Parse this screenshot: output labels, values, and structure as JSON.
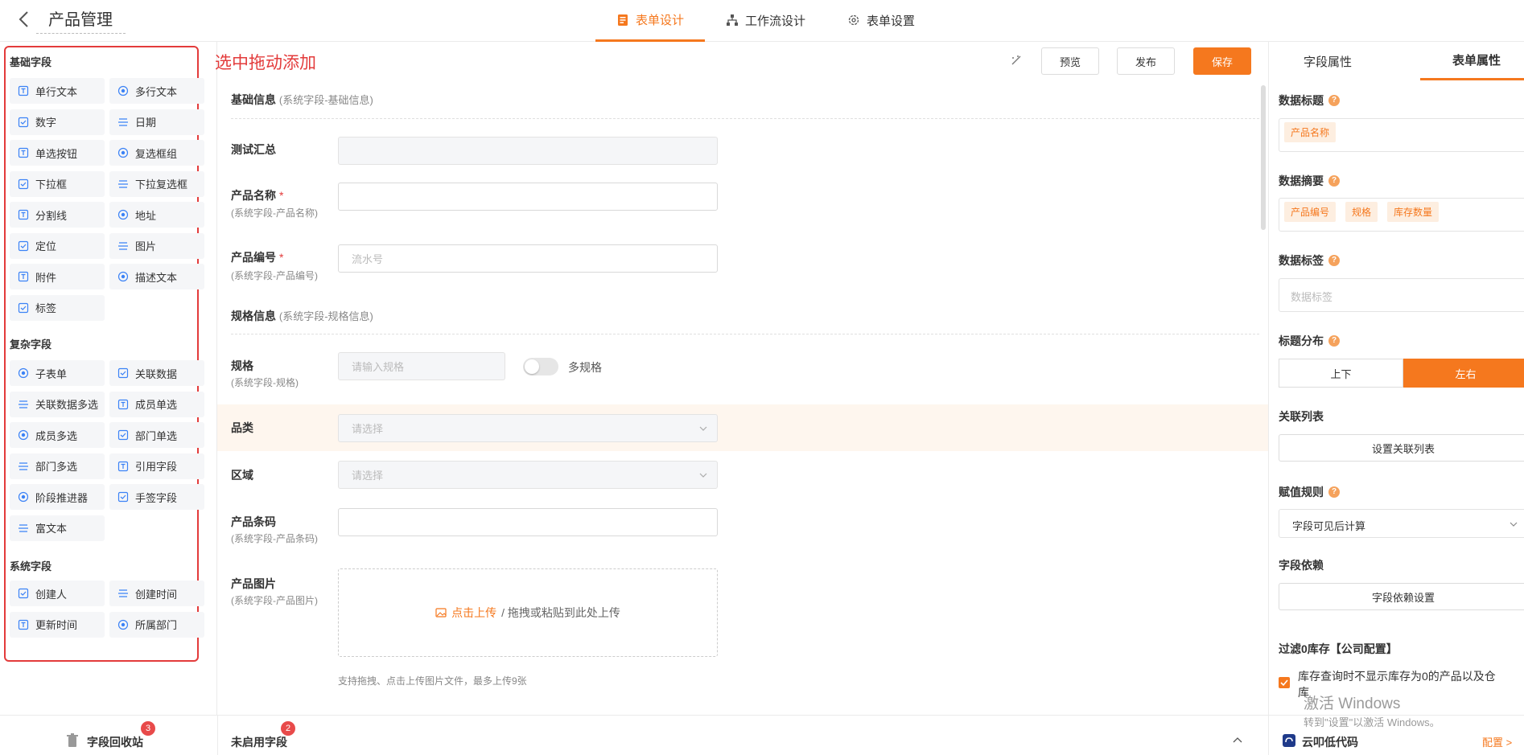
{
  "header": {
    "title": "产品管理",
    "tabs": [
      {
        "label": "表单设计",
        "active": true
      },
      {
        "label": "工作流设计"
      },
      {
        "label": "表单设置"
      }
    ]
  },
  "left": {
    "sections": [
      {
        "title": "基础字段",
        "items": [
          "单行文本",
          "多行文本",
          "数字",
          "日期",
          "单选按钮",
          "复选框组",
          "下拉框",
          "下拉复选框",
          "分割线",
          "地址",
          "定位",
          "图片",
          "附件",
          "描述文本",
          "标签"
        ]
      },
      {
        "title": "复杂字段",
        "items": [
          "子表单",
          "关联数据",
          "关联数据多选",
          "成员单选",
          "成员多选",
          "部门单选",
          "部门多选",
          "引用字段",
          "阶段推进器",
          "手签字段",
          "富文本"
        ]
      },
      {
        "title": "系统字段",
        "items": [
          "创建人",
          "创建时间",
          "更新时间",
          "所属部门"
        ]
      }
    ],
    "recycle": {
      "label": "字段回收站",
      "count": "3"
    }
  },
  "center": {
    "hint": "选中拖动添加",
    "toolbar": {
      "preview": "预览",
      "publish": "发布",
      "save": "保存"
    },
    "group1": {
      "title": "基础信息",
      "note": "(系统字段-基础信息)"
    },
    "f_total": {
      "label": "测试汇总"
    },
    "f_name": {
      "label": "产品名称",
      "sub": "(系统字段-产品名称)"
    },
    "f_code": {
      "label": "产品编号",
      "sub": "(系统字段-产品编号)",
      "placeholder": "流水号"
    },
    "group2": {
      "title": "规格信息",
      "note": "(系统字段-规格信息)"
    },
    "f_spec": {
      "label": "规格",
      "sub": "(系统字段-规格)",
      "placeholder": "请输入规格",
      "toggle": "多规格"
    },
    "f_cat": {
      "label": "品类",
      "placeholder": "请选择"
    },
    "f_area": {
      "label": "区域",
      "placeholder": "请选择"
    },
    "f_barcode": {
      "label": "产品条码",
      "sub": "(系统字段-产品条码)"
    },
    "f_img": {
      "label": "产品图片",
      "sub": "(系统字段-产品图片)",
      "upload": "点击上传",
      "upload_rest": "/ 拖拽或粘贴到此处上传",
      "help": "支持拖拽、点击上传图片文件，最多上传9张"
    },
    "unused": {
      "label": "未启用字段",
      "count": "2"
    }
  },
  "right": {
    "tabs": [
      "字段属性",
      "表单属性"
    ],
    "data_title": {
      "label": "数据标题",
      "tags": [
        "产品名称"
      ]
    },
    "data_summary": {
      "label": "数据摘要",
      "tags": [
        "产品编号",
        "规格",
        "库存数量"
      ]
    },
    "data_tag": {
      "label": "数据标签",
      "placeholder": "数据标签"
    },
    "title_layout": {
      "label": "标题分布",
      "options": [
        "上下",
        "左右"
      ],
      "selected": "左右"
    },
    "rel_list": {
      "label": "关联列表",
      "button": "设置关联列表"
    },
    "assign": {
      "label": "赋值规则",
      "value": "字段可见后计算"
    },
    "depend": {
      "label": "字段依赖",
      "button": "字段依赖设置"
    },
    "filter": {
      "label": "过滤0库存【公司配置】",
      "text1": "库存查询时不显示库存为0的产品以及仓",
      "text2": "库"
    },
    "footer": {
      "brand": "云叩低代码",
      "config": "配置 >"
    }
  },
  "watermark": {
    "line1": "激活 Windows",
    "line2": "转到\"设置\"以激活 Windows。"
  }
}
